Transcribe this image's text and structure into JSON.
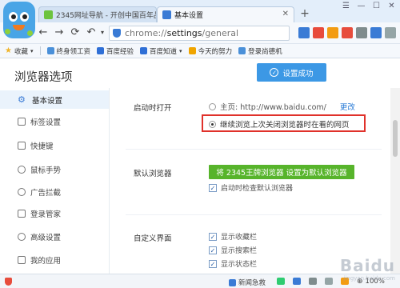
{
  "browser": {
    "tabs": [
      {
        "title": "2345网址导航 - 开创中国百年品",
        "active": false
      },
      {
        "title": "基本设置",
        "active": true
      }
    ],
    "new_tab": "+",
    "address": {
      "scheme": "chrome://",
      "path": "settings",
      "rest": "/general"
    },
    "bookmarks": [
      {
        "label": "收藏",
        "icon": "star-icon"
      },
      {
        "label": "终身领工资",
        "icon": "page-icon"
      },
      {
        "label": "百度经验",
        "icon": "baidu-icon"
      },
      {
        "label": "百度知道",
        "icon": "baidu-icon"
      },
      {
        "label": "今天的努力",
        "icon": "folder-icon"
      },
      {
        "label": "登录尚德机",
        "icon": "page-icon"
      }
    ],
    "colors": {
      "accent": "#3c98e5",
      "green": "#57b42b",
      "highlight": "#e0322b"
    }
  },
  "page": {
    "title": "浏览器选项",
    "success_button": "设置成功",
    "sidebar": [
      {
        "label": "基本设置",
        "active": true
      },
      {
        "label": "标签设置"
      },
      {
        "label": "快捷键"
      },
      {
        "label": "鼠标手势"
      },
      {
        "label": "广告拦截"
      },
      {
        "label": "登录管家"
      },
      {
        "label": "高级设置"
      },
      {
        "label": "我的应用"
      }
    ],
    "startup": {
      "label": "启动时打开",
      "home_option": "主页: http://www.baidu.com/",
      "change_link": "更改",
      "continue_option": "继续浏览上次关闭浏览器时在看的网页"
    },
    "default_browser": {
      "label": "默认浏览器",
      "button": "将 2345王牌浏览器 设置为默认浏览器",
      "check_label": "启动时检查默认浏览器"
    },
    "customize": {
      "label": "自定义界面",
      "options": [
        "显示收藏栏",
        "显示搜索栏",
        "显示状态栏"
      ]
    }
  },
  "statusbar": {
    "news": "新闻急救",
    "zoom": "100%"
  },
  "watermark": {
    "text": "Baidu",
    "sub": "jingyan.baidu.com"
  }
}
